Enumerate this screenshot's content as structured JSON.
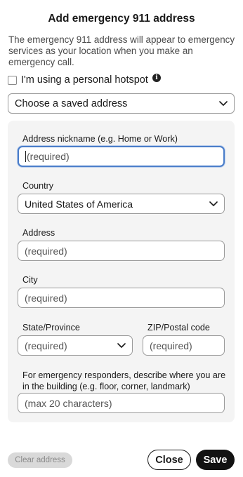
{
  "dialog": {
    "title": "Add emergency 911 address",
    "description": "The emergency 911 address will appear to emergency services as your location when you make an emergency call."
  },
  "hotspot": {
    "label": "I'm using a personal hotspot",
    "checked": false,
    "info_icon": "info-icon"
  },
  "saved_address": {
    "selected": "Choose a saved address"
  },
  "form": {
    "nickname": {
      "label": "Address nickname (e.g. Home or Work)",
      "placeholder": "(required)"
    },
    "country": {
      "label": "Country",
      "selected": "United States of America"
    },
    "address": {
      "label": "Address",
      "placeholder": "(required)"
    },
    "city": {
      "label": "City",
      "placeholder": "(required)"
    },
    "state": {
      "label": "State/Province",
      "selected": "(required)"
    },
    "zip": {
      "label": "ZIP/Postal code",
      "placeholder": "(required)"
    },
    "location_desc": {
      "label": "For emergency responders, describe where you are in the building (e.g. floor, corner, landmark)",
      "placeholder": "(max 20 characters)"
    }
  },
  "footer": {
    "clear_label": "Clear address",
    "close_label": "Close",
    "save_label": "Save"
  },
  "colors": {
    "focus_border": "#4a7dc9",
    "primary_button": "#121212",
    "panel_bg": "#f4f4f4"
  }
}
